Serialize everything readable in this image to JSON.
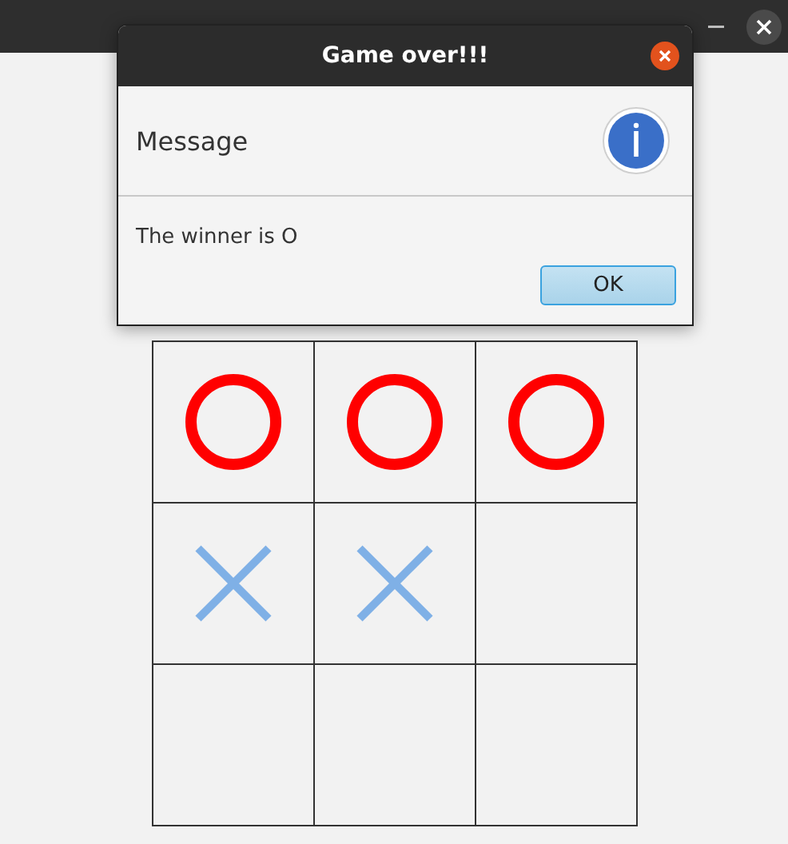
{
  "board": {
    "cells": [
      {
        "kind": "o"
      },
      {
        "kind": "o"
      },
      {
        "kind": "o"
      },
      {
        "kind": "x"
      },
      {
        "kind": "x"
      },
      {
        "kind": "empty"
      },
      {
        "kind": "empty"
      },
      {
        "kind": "empty"
      },
      {
        "kind": "empty"
      }
    ]
  },
  "dialog": {
    "title": "Game over!!!",
    "header": "Message",
    "message": "The winner is O",
    "buttons": [
      "OK"
    ]
  }
}
